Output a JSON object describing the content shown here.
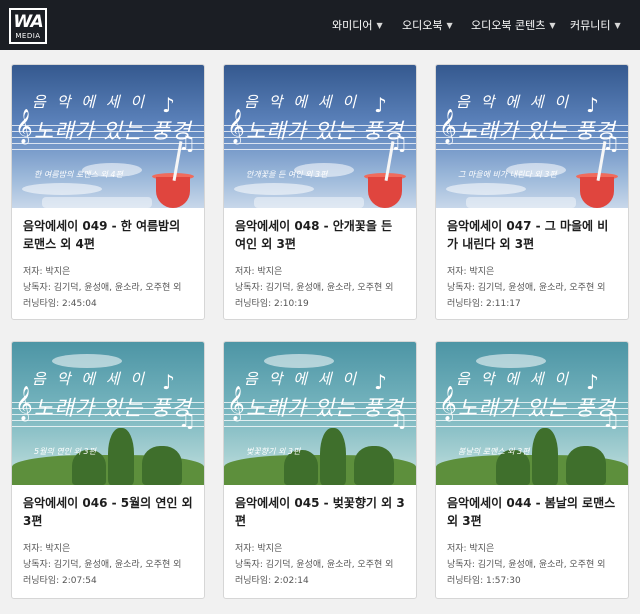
{
  "header": {
    "logo_big": "WA",
    "logo_small": "MEDIA",
    "nav": [
      {
        "label": "와미디어"
      },
      {
        "label": "오디오북"
      },
      {
        "label": "오디오북 콘텐츠"
      },
      {
        "label": "커뮤니티"
      }
    ],
    "chevron_icon": "chevron-down-icon"
  },
  "cover": {
    "line1": "음 악 에 세 이",
    "line2": "노래가 있는 풍경"
  },
  "cards": [
    {
      "cover_style": "summer",
      "cover_subtitle": "한 여름밤의 로맨스 외 4편",
      "title": "음악에세이 049 - 한 여름밤의 로맨스 외 4편",
      "author": "저자: 박지은",
      "narrators": "낭독자: 김기덕, 윤성애, 윤소라, 오주현 외",
      "runtime": "러닝타임: 2:45:04"
    },
    {
      "cover_style": "summer",
      "cover_subtitle": "안개꽃을 든 여인 외 3편",
      "title": "음악에세이 048 - 안개꽃을 든 여인 외 3편",
      "author": "저자: 박지은",
      "narrators": "낭독자: 김기덕, 윤성애, 윤소라, 오주현 외",
      "runtime": "러닝타임: 2:10:19"
    },
    {
      "cover_style": "summer",
      "cover_subtitle": "그 마을에 비가 내린다 외 3편",
      "title": "음악에세이 047 - 그 마을에 비가 내린다 외 3편",
      "author": "저자: 박지은",
      "narrators": "낭독자: 김기덕, 윤성애, 윤소라, 오주현 외",
      "runtime": "러닝타임: 2:11:17"
    },
    {
      "cover_style": "spring",
      "cover_subtitle": "5월의 연인 외 3편",
      "title": "음악에세이 046 - 5월의 연인 외 3편",
      "author": "저자: 박지은",
      "narrators": "낭독자: 김기덕, 윤성애, 윤소라, 오주현 외",
      "runtime": "러닝타임: 2:07:54"
    },
    {
      "cover_style": "spring",
      "cover_subtitle": "벚꽃향기 외 3편",
      "title": "음악에세이 045 - 벚꽃향기 외 3편",
      "author": "저자: 박지은",
      "narrators": "낭독자: 김기덕, 윤성애, 윤소라, 오주현 외",
      "runtime": "러닝타임: 2:02:14"
    },
    {
      "cover_style": "spring",
      "cover_subtitle": "봄날의 로맨스 외 3편",
      "title": "음악에세이 044 - 봄날의 로맨스 외 3편",
      "author": "저자: 박지은",
      "narrators": "낭독자: 김기덕, 윤성애, 윤소라, 오주현 외",
      "runtime": "러닝타임: 1:57:30"
    }
  ],
  "colors": {
    "header_bg": "#1b1e24",
    "summer_cover": "#4a6fa8",
    "spring_cover": "#6fb0bb",
    "card_bg": "#ffffff"
  }
}
